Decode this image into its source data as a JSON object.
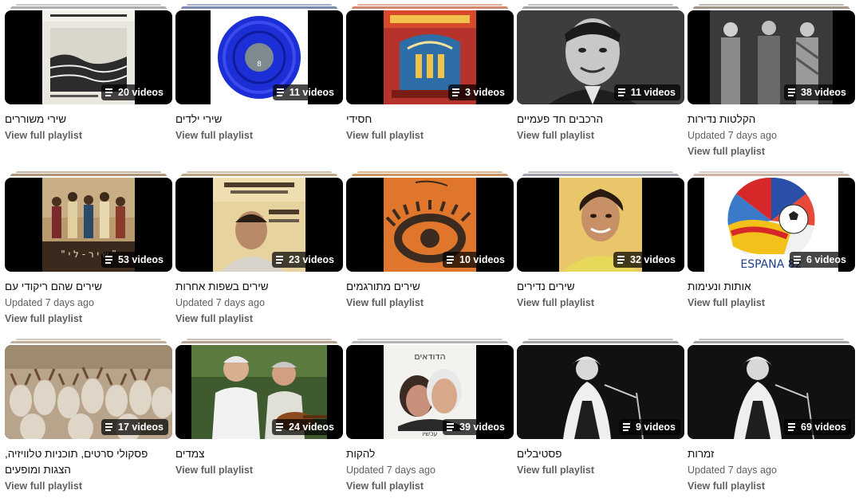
{
  "view_full_playlist": "View full playlist",
  "updated_text": "Updated 7 days ago",
  "cards": [
    {
      "title": "שירי משוררים",
      "count": "20 videos",
      "updated": false,
      "stack": "#9a9a9a"
    },
    {
      "title": "שירי ילדים",
      "count": "11 videos",
      "updated": false,
      "stack": "#5b6b9e"
    },
    {
      "title": "חסידי",
      "count": "3 videos",
      "updated": false,
      "stack": "#c46a4a"
    },
    {
      "title": "הרכבים חד פעמיים",
      "count": "11 videos",
      "updated": false,
      "stack": "#8a8a8a"
    },
    {
      "title": "הקלטות נדירות",
      "count": "38 videos",
      "updated": true,
      "stack": "#8a7a6a"
    },
    {
      "title": "שירים שהם ריקודי עם",
      "count": "53 videos",
      "updated": true,
      "stack": "#a07a5a"
    },
    {
      "title": "שירים בשפות אחרות",
      "count": "23 videos",
      "updated": true,
      "stack": "#b09060"
    },
    {
      "title": "שירים מתורגמים",
      "count": "10 videos",
      "updated": false,
      "stack": "#c07a3a"
    },
    {
      "title": "שירים נדירים",
      "count": "32 videos",
      "updated": false,
      "stack": "#8a8a9a"
    },
    {
      "title": "אותות ונעימות",
      "count": "6 videos",
      "updated": false,
      "stack": "#c0a090"
    },
    {
      "title": "פסקולי סרטים, תוכניות טלוויזיה, הצגות ומופעים",
      "count": "17 videos",
      "updated": false,
      "stack": "#b09a80"
    },
    {
      "title": "צמדים",
      "count": "24 videos",
      "updated": false,
      "stack": "#a08a70"
    },
    {
      "title": "להקות",
      "count": "39 videos",
      "updated": true,
      "stack": "#a0a0a0"
    },
    {
      "title": "פסטיבלים",
      "count": "9 videos",
      "updated": false,
      "stack": "#888888"
    },
    {
      "title": "זמרות",
      "count": "69 videos",
      "updated": true,
      "stack": "#888888"
    }
  ],
  "artwork": {
    "a11_text": "ESPANA 82",
    "a13_header": "הדודאים",
    "a13_footer": "עכשיו"
  }
}
